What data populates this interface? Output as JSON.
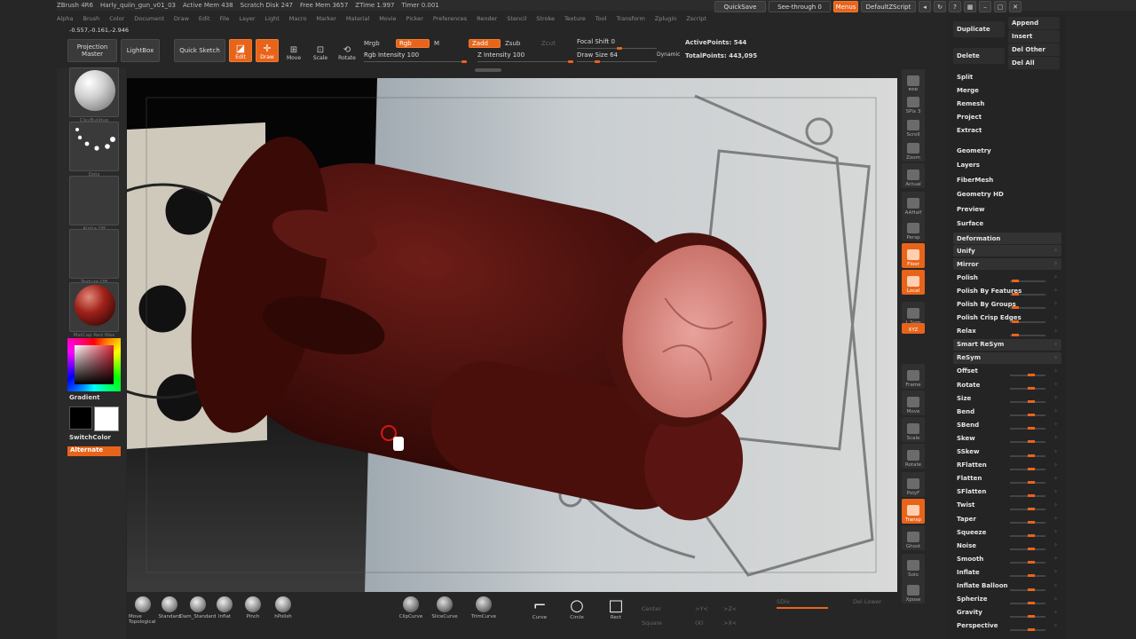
{
  "app": {
    "name": "ZBrush 4R6",
    "document": "Harly_quiin_gun_v01_03",
    "active_mem": "Active Mem 438",
    "scratch": "Scratch Disk 247",
    "free_mem": "Free Mem 3657",
    "ztime": "ZTime 1.997",
    "timer": "Timer 0.001",
    "coords": "-0.557,-0.161,-2.946"
  },
  "menus": [
    "Alpha",
    "Brush",
    "Color",
    "Document",
    "Draw",
    "Edit",
    "File",
    "Layer",
    "Light",
    "Macro",
    "Marker",
    "Material",
    "Movie",
    "Picker",
    "Preferences",
    "Render",
    "Stencil",
    "Stroke",
    "Texture",
    "Tool",
    "Transform",
    "Zplugin",
    "Zscript"
  ],
  "topright": {
    "quicksave": "QuickSave",
    "seethrough": "See-through  0",
    "menus": "Menus",
    "script": "DefaultZScript"
  },
  "shelf": {
    "projection_master": "Projection Master",
    "lightbox": "LightBox",
    "quick_sketch": "Quick Sketch",
    "edit": "Edit",
    "draw": "Draw",
    "move": "Move",
    "scale": "Scale",
    "rotate": "Rotate",
    "mrgb": "Mrgb",
    "rgb": "Rgb",
    "m": "M",
    "zadd": "Zadd",
    "zsub": "Zsub",
    "zcut": "Zcut",
    "rgb_intensity": "Rgb Intensity 100",
    "z_intensity": "Z Intensity 100",
    "focal_shift": "Focal Shift 0",
    "draw_size": "Draw Size 64",
    "dynamic": "Dynamic",
    "active_points": "ActivePoints: 544",
    "total_points": "TotalPoints: 443,095"
  },
  "left_tray": {
    "brush_label": "ClayBuildup",
    "stroke_label": "Dots",
    "alpha_label": "Alpha Off",
    "texture_label": "Texture Off",
    "material_label": "MatCap Red Wax",
    "gradient": "Gradient",
    "switchcolor": "SwitchColor",
    "alternate": "Alternate"
  },
  "right_icons": [
    "BPR",
    "SPix 3",
    "Scroll",
    "Zoom",
    "Actual",
    "AAHalf",
    "Persp",
    "Floor",
    "Local",
    "L.Sym",
    "XYZ",
    "",
    "Frame",
    "Move",
    "Scale",
    "Rotate",
    "PolyF",
    "Transp",
    "Ghost",
    "Solo",
    "Xpose"
  ],
  "subtool": {
    "duplicate": "Duplicate",
    "append": "Append",
    "insert": "Insert",
    "delete": "Delete",
    "del_other": "Del Other",
    "del_all": "Del All",
    "split": "Split",
    "merge": "Merge",
    "remesh": "Remesh",
    "project": "Project",
    "extract": "Extract"
  },
  "sections": [
    "Geometry",
    "Layers",
    "FiberMesh",
    "Geometry HD",
    "Preview",
    "Surface",
    "Deformation"
  ],
  "deformation": [
    {
      "label": "Unify",
      "slider": false
    },
    {
      "label": "Mirror",
      "slider": false
    },
    {
      "label": "Polish",
      "slider": true,
      "v": 0.05
    },
    {
      "label": "Polish By Features",
      "slider": true,
      "v": 0.05
    },
    {
      "label": "Polish By Groups",
      "slider": true,
      "v": 0.05
    },
    {
      "label": "Polish Crisp Edges",
      "slider": true,
      "v": 0.05
    },
    {
      "label": "Relax",
      "slider": true,
      "v": 0.05
    },
    {
      "label": "Smart ReSym",
      "slider": false
    },
    {
      "label": "ReSym",
      "slider": false
    },
    {
      "label": "Offset",
      "slider": true,
      "v": 0.5
    },
    {
      "label": "Rotate",
      "slider": true,
      "v": 0.5
    },
    {
      "label": "Size",
      "slider": true,
      "v": 0.5
    },
    {
      "label": "Bend",
      "slider": true,
      "v": 0.5
    },
    {
      "label": "SBend",
      "slider": true,
      "v": 0.5
    },
    {
      "label": "Skew",
      "slider": true,
      "v": 0.5
    },
    {
      "label": "SSkew",
      "slider": true,
      "v": 0.5
    },
    {
      "label": "RFlatten",
      "slider": true,
      "v": 0.5
    },
    {
      "label": "Flatten",
      "slider": true,
      "v": 0.5
    },
    {
      "label": "SFlatten",
      "slider": true,
      "v": 0.5
    },
    {
      "label": "Twist",
      "slider": true,
      "v": 0.5
    },
    {
      "label": "Taper",
      "slider": true,
      "v": 0.5
    },
    {
      "label": "Squeeze",
      "slider": true,
      "v": 0.5
    },
    {
      "label": "Noise",
      "slider": true,
      "v": 0.5
    },
    {
      "label": "Smooth",
      "slider": true,
      "v": 0.5
    },
    {
      "label": "Inflate",
      "slider": true,
      "v": 0.5
    },
    {
      "label": "Inflate Balloon",
      "slider": true,
      "v": 0.5
    },
    {
      "label": "Spherize",
      "slider": true,
      "v": 0.5
    },
    {
      "label": "Gravity",
      "slider": true,
      "v": 0.5
    },
    {
      "label": "Perspective",
      "slider": true,
      "v": 0.5
    }
  ],
  "bottom": {
    "brushes": [
      "Move Topological",
      "Standard",
      "Dam_Standard",
      "Inflat",
      "Pinch",
      "hPolish"
    ],
    "clip": [
      "ClipCurve",
      "SliceCurve",
      "TrimCurve"
    ],
    "curve": "Curve",
    "circle": "Circle",
    "rect": "Rect",
    "center": "Center",
    "square": "Square",
    "xy": ">Y<",
    ">z<": ">Z<",
    "xx": "(X)",
    "xx2": ">X<",
    "sdiv": "SDiv",
    "del_lower": "Del Lower"
  },
  "colors": {
    "accent": "#e8641b",
    "model": "#5a1512",
    "bg": "#262626"
  }
}
